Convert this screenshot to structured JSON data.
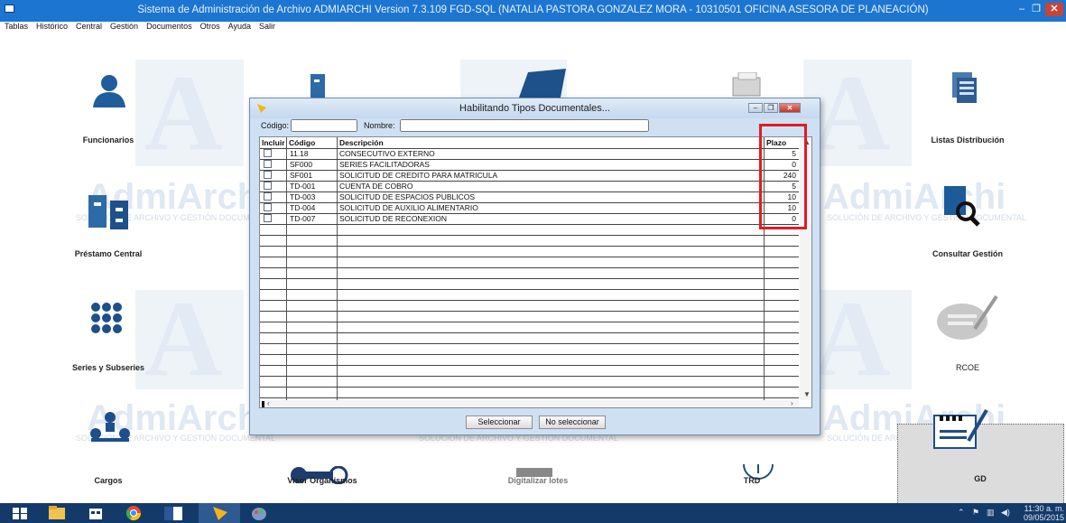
{
  "window": {
    "title": "Sistema de Administración de Archivo ADMIARCHI Version 7.3.109 FGD-SQL (NATALIA PASTORA GONZALEZ MORA - 10310501 OFICINA ASESORA DE PLANEACIÓN)",
    "minimize": "–",
    "restore": "❐",
    "close": "✕"
  },
  "menu": [
    "Tablas",
    "Histórico",
    "Central",
    "Gestión",
    "Documentos",
    "Otros",
    "Ayuda",
    "Salir"
  ],
  "watermark": {
    "letter": "A",
    "brand": "AdmiArchi",
    "tagline": "SOLUCIÓN DE ARCHIVO Y GESTIÓN DOCUMENTAL"
  },
  "desktop": {
    "funcionarios": "Funcionarios",
    "listas": "Listas Distribución",
    "prestamo": "Préstamo Central",
    "consultar": "Consultar Gestión",
    "series": "Series y Subseries",
    "rcoe": "RCOE",
    "cargos": "Cargos",
    "visor": "Visor Organismos",
    "digitalizar": "Digitalizar lotes",
    "trd": "TRD",
    "gd": "GD"
  },
  "dialog": {
    "title": "Habilitando Tipos Documentales...",
    "codigo_label": "Código:",
    "nombre_label": "Nombre:",
    "codigo_value": "",
    "nombre_value": "",
    "columns": {
      "incluir": "Incluir",
      "codigo": "Código",
      "descripcion": "Descripción",
      "plazo": "Plazo"
    },
    "rows": [
      {
        "codigo": "11.18",
        "descripcion": "CONSECUTIVO EXTERNO",
        "plazo": "5",
        "incluir": false
      },
      {
        "codigo": "SF000",
        "descripcion": "SERIES FACILITADORAS",
        "plazo": "0",
        "incluir": false
      },
      {
        "codigo": "SF001",
        "descripcion": "SOLICITUD DE CREDITO PARA MATRICULA",
        "plazo": "240",
        "incluir": false
      },
      {
        "codigo": "TD-001",
        "descripcion": "CUENTA DE COBRO",
        "plazo": "5",
        "incluir": false
      },
      {
        "codigo": "TD-003",
        "descripcion": "SOLICITUD DE ESPACIOS PUBLICOS",
        "plazo": "10",
        "incluir": false
      },
      {
        "codigo": "TD-004",
        "descripcion": "SOLICITUD DE AUXILIO ALIMENTARIO",
        "plazo": "10",
        "incluir": false
      },
      {
        "codigo": "TD-007",
        "descripcion": "SOLICITUD DE RECONEXION",
        "plazo": "0",
        "incluir": false
      }
    ],
    "seleccionar": "Seleccionar",
    "no_seleccionar": "No seleccionar"
  },
  "taskbar": {
    "time": "11:30 a. m.",
    "date": "09/05/2015"
  },
  "colors": {
    "titlebar": "#1c75d1",
    "taskbar": "#143a6a",
    "highlight": "#e01c24",
    "dialog": "#cfe0f3"
  }
}
